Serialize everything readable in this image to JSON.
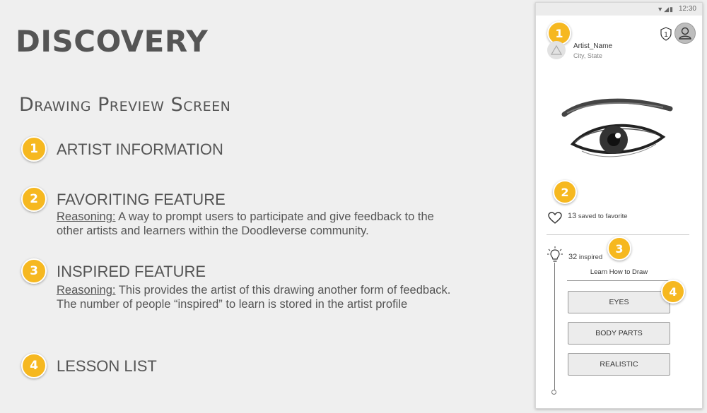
{
  "title": "DISCOVERY",
  "subtitle": "Drawing Preview Screen",
  "features": [
    {
      "number": "1",
      "title": "ARTIST INFORMATION"
    },
    {
      "number": "2",
      "title": "FAVORITING FEATURE",
      "reasoning_label": "Reasoning:",
      "reasoning_text": " A way to prompt users to participate and give feedback to the other artists and learners within the Doodleverse community."
    },
    {
      "number": "3",
      "title": "INSPIRED FEATURE",
      "reasoning_label": "Reasoning:",
      "reasoning_text": " This provides the artist of this drawing another form of feedback. The number of people “inspired” to learn is stored in the artist profile"
    },
    {
      "number": "4",
      "title": "LESSON LIST"
    }
  ],
  "phone": {
    "time": "12:30",
    "badge_count": "1",
    "artist_name": "Artist_Name",
    "artist_location": "City, State",
    "saved_count": "13",
    "saved_text": " saved to favorite",
    "inspired_count": "32",
    "inspired_text": " inspired",
    "learn_label": "Learn How to Draw",
    "lessons": [
      "EYES",
      "BODY PARTS",
      "REALISTIC"
    ]
  },
  "colors": {
    "badge": "#f6b820",
    "background": "#efefef",
    "text": "#555555"
  }
}
